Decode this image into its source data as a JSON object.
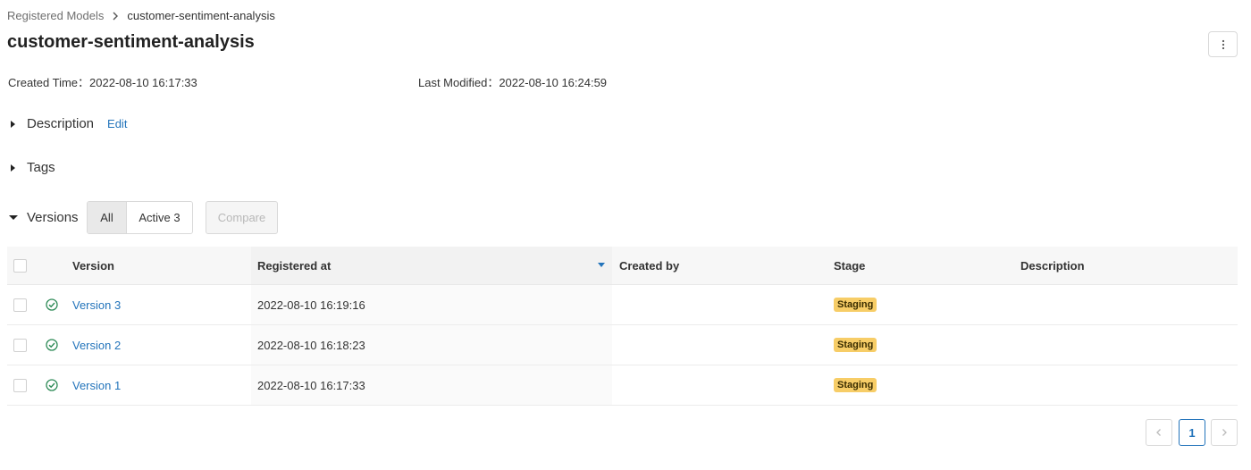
{
  "breadcrumb": {
    "parent": "Registered Models",
    "current": "customer-sentiment-analysis"
  },
  "page_title": "customer-sentiment-analysis",
  "meta": {
    "created_label": "Created Time：",
    "created_value": "2022-08-10 16:17:33",
    "modified_label": "Last Modified：",
    "modified_value": "2022-08-10 16:24:59"
  },
  "sections": {
    "description": "Description",
    "edit": "Edit",
    "tags": "Tags",
    "versions": "Versions"
  },
  "filters": {
    "all": "All",
    "active": "Active 3",
    "compare": "Compare"
  },
  "table": {
    "columns": [
      "Version",
      "Registered at",
      "Created by",
      "Stage",
      "Description"
    ],
    "rows": [
      {
        "version": "Version 3",
        "registered_at": "2022-08-10 16:19:16",
        "created_by": "",
        "stage": "Staging",
        "description": ""
      },
      {
        "version": "Version 2",
        "registered_at": "2022-08-10 16:18:23",
        "created_by": "",
        "stage": "Staging",
        "description": ""
      },
      {
        "version": "Version 1",
        "registered_at": "2022-08-10 16:17:33",
        "created_by": "",
        "stage": "Staging",
        "description": ""
      }
    ]
  },
  "pagination": {
    "current_page": "1"
  },
  "colors": {
    "link": "#2374bb",
    "stage_badge": "#f7cd67",
    "status_ok": "#2e8b57"
  }
}
